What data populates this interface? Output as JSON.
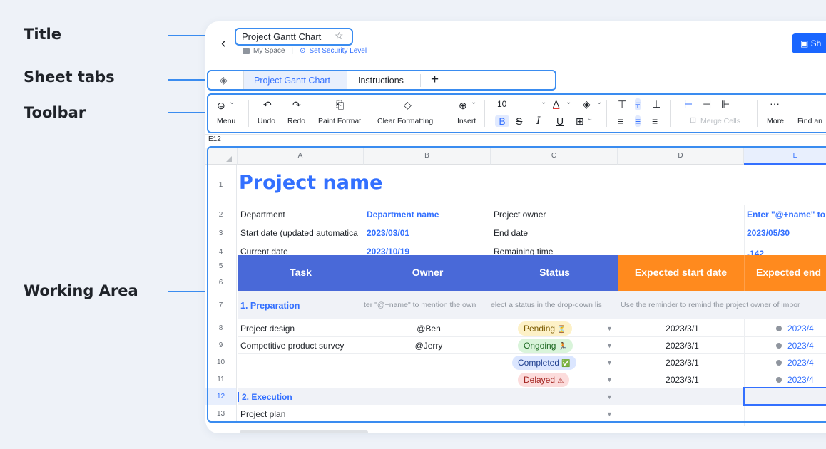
{
  "callouts": {
    "title": "Title",
    "sheet_tabs": "Sheet tabs",
    "toolbar": "Toolbar",
    "working_area": "Working Area"
  },
  "header": {
    "back_icon": "‹",
    "title": "Project Gantt Chart",
    "star_icon": "☆",
    "breadcrumb": "My Space",
    "security": "Set Security Level",
    "share_label": "Sh"
  },
  "tabs": {
    "layers_icon": "◈",
    "items": [
      {
        "label": "Project Gantt Chart",
        "active": true
      },
      {
        "label": "Instructions",
        "active": false
      }
    ],
    "add_icon": "+"
  },
  "toolbar": {
    "menu": "Menu",
    "undo": "Undo",
    "redo": "Redo",
    "paint_format": "Paint Format",
    "clear_formatting": "Clear Formatting",
    "insert": "Insert",
    "font_size": "10",
    "merge_cells": "Merge Cells",
    "more": "More",
    "find": "Find an",
    "icons": {
      "menu": "⊜",
      "undo": "↶",
      "redo": "↷",
      "paint": "⎗",
      "clear": "◇",
      "insert": "⊕",
      "color_a": "A",
      "fill": "◈",
      "top": "⊤",
      "mid": "⫩",
      "bottom": "⊥",
      "bold": "B",
      "strike": "S",
      "italic": "I",
      "underline": "U",
      "border": "⊞",
      "left": "≡",
      "center": "≡",
      "right": "≡",
      "merge": "⊞",
      "more": "···",
      "dots": "⋮",
      "chev": "⌄"
    }
  },
  "cellref": "E12",
  "grid": {
    "columns": [
      "A",
      "B",
      "C",
      "D",
      "E"
    ],
    "rows": [
      "1",
      "2",
      "3",
      "4",
      "5",
      "6",
      "7",
      "8",
      "9",
      "10",
      "11",
      "12",
      "13"
    ],
    "project_name": "Project name",
    "info": {
      "department_label": "Department",
      "department_value": "Department name",
      "owner_label": "Project owner",
      "owner_value": "Enter \"@+name\" to",
      "start_label": "Start date (updated automatica",
      "start_value": "2023/03/01",
      "end_label": "End date",
      "end_value": "2023/05/30",
      "current_label": "Current date",
      "current_value": "2023/10/19",
      "remaining_label": "Remaining time",
      "remaining_value": "-142"
    },
    "table_headers": [
      "Task",
      "Owner",
      "Status",
      "Expected start date",
      "Expected end"
    ],
    "header_colors": {
      "blue": "#4969d8",
      "orange": "#ff8a1e"
    },
    "section1": "1. Preparation",
    "hint_owner": "ter \"@+name\" to mention the own",
    "hint_status": "elect a status in the drop-down lis",
    "hint_reminder": "Use the reminder to remind the project owner of impor",
    "tasks": [
      {
        "task": "Project design",
        "owner": "@Ben",
        "status": "Pending",
        "status_icon": "⏳",
        "start": "2023/3/1",
        "end": "2023/4"
      },
      {
        "task": "Competitive product survey",
        "owner": "@Jerry",
        "status": "Ongoing",
        "status_icon": "🏃",
        "start": "2023/3/1",
        "end": "2023/4"
      },
      {
        "task": "",
        "owner": "",
        "status": "Completed",
        "status_icon": "✅",
        "start": "2023/3/1",
        "end": "2023/4"
      },
      {
        "task": "",
        "owner": "",
        "status": "Delayed",
        "status_icon": "⚠",
        "start": "2023/3/1",
        "end": "2023/4"
      }
    ],
    "section2": "2. Execution",
    "row13_task": "Project plan",
    "status_colors": {
      "pending": "#fdf1c7",
      "ongoing": "#d9f4da",
      "completed": "#dbe6ff",
      "delayed": "#fcdcdc"
    }
  }
}
